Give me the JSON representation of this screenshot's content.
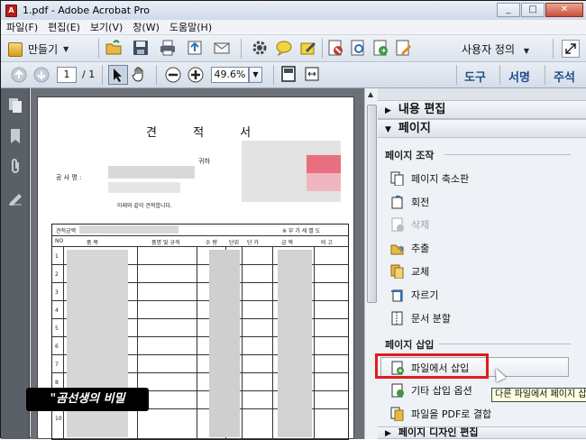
{
  "window": {
    "title": "1.pdf - Adobe Acrobat Pro",
    "controls": {
      "minimize": "_",
      "maximize": "□",
      "close": "✕"
    }
  },
  "menu": [
    "파일(F)",
    "편집(E)",
    "보기(V)",
    "창(W)",
    "도움말(H)"
  ],
  "toolbar": {
    "create_label": "만들기",
    "user_defined_label": "사용자 정의",
    "page_current": "1",
    "page_total": "/ 1",
    "zoom_value": "49.6%",
    "right_tabs": [
      "도구",
      "서명",
      "주석"
    ]
  },
  "document": {
    "title": "견 적 서",
    "honorific": "귀하",
    "company_label": "공 사 명 :",
    "message": "아래와 같이 견적합니다.",
    "table_header_left": "견적금액",
    "table_header_right": "※ 부 가 세 별 도",
    "columns": [
      "NO",
      "품 목",
      "품명 및 규격",
      "수 량",
      "단위",
      "단 가",
      "금 액",
      "비 고"
    ],
    "row_numbers": [
      "1",
      "2",
      "3",
      "4",
      "5",
      "6",
      "7",
      "8",
      "9",
      "10"
    ]
  },
  "tools_panel": {
    "sections": {
      "content_edit": "내용 편집",
      "pages": "페이지",
      "page_design": "페이지 디자인 편집"
    },
    "groups": {
      "page_manipulation": "페이지 조작",
      "insert_pages": "페이지 삽입"
    },
    "page_manipulation_items": [
      {
        "label": "페이지 축소판",
        "icon": "thumbnails-icon",
        "enabled": true
      },
      {
        "label": "회전",
        "icon": "rotate-icon",
        "enabled": true
      },
      {
        "label": "삭제",
        "icon": "delete-icon",
        "enabled": false
      },
      {
        "label": "추출",
        "icon": "extract-icon",
        "enabled": true
      },
      {
        "label": "교체",
        "icon": "replace-icon",
        "enabled": true
      },
      {
        "label": "자르기",
        "icon": "crop-icon",
        "enabled": true
      },
      {
        "label": "문서 분할",
        "icon": "split-icon",
        "enabled": true
      }
    ],
    "insert_items": [
      {
        "label": "파일에서 삽입",
        "icon": "insert-from-file-icon"
      },
      {
        "label": "기타 삽입 옵션",
        "icon": "more-insert-icon"
      },
      {
        "label": "파일을 PDF로 결합",
        "icon": "combine-icon"
      }
    ],
    "tooltip": "다른 파일에서 페이지 삽"
  },
  "watermark_text": "\"곰선생의 비밀",
  "colors": {
    "highlight": "#e21b1b",
    "accent": "#1a4f8a"
  }
}
